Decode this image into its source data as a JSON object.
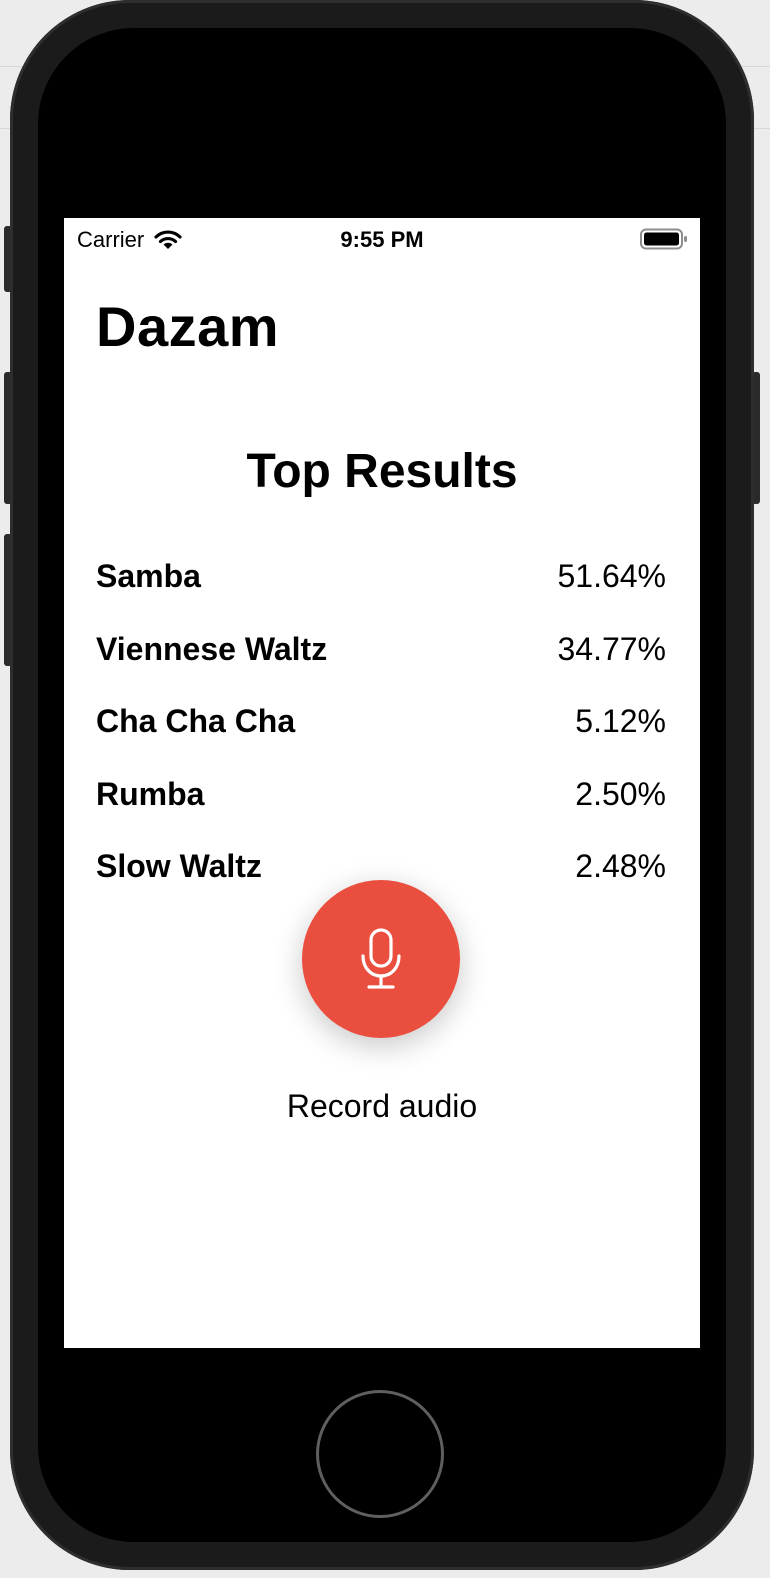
{
  "status_bar": {
    "carrier": "Carrier",
    "time": "9:55 PM",
    "wifi_icon": "wifi-icon",
    "battery_icon": "battery-full-icon"
  },
  "app": {
    "title": "Dazam"
  },
  "results": {
    "heading": "Top Results",
    "items": [
      {
        "name": "Samba",
        "percent": "51.64%"
      },
      {
        "name": "Viennese Waltz",
        "percent": "34.77%"
      },
      {
        "name": "Cha Cha Cha",
        "percent": "5.12%"
      },
      {
        "name": "Rumba",
        "percent": "2.50%"
      },
      {
        "name": "Slow Waltz",
        "percent": "2.48%"
      }
    ]
  },
  "record": {
    "icon": "microphone-icon",
    "label": "Record audio",
    "accent_color": "#EA4E3E"
  }
}
